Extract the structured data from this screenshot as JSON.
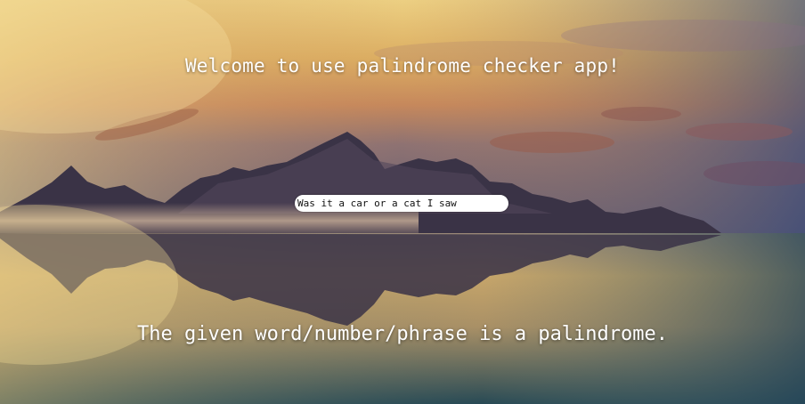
{
  "app": {
    "heading": "Welcome to use palindrome checker app!",
    "input": {
      "value": "Was it a car or a cat I saw",
      "placeholder": ""
    },
    "result_message": "The given word/number/phrase is a palindrome."
  },
  "background": {
    "scene": "mountain-lake-sunset",
    "colors": {
      "sky_top": "#e8c777",
      "sky_mid": "#c9875a",
      "mountain": "#3b3446",
      "water_bottom": "#2e4e58",
      "text": "#ffffff"
    }
  }
}
